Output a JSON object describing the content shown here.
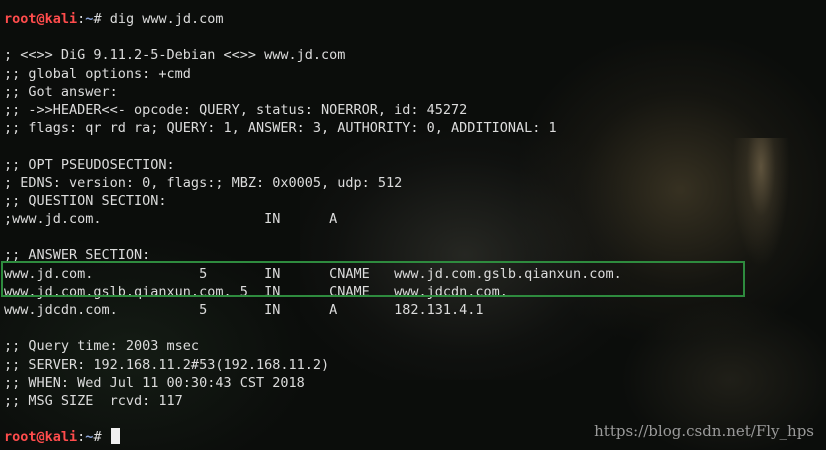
{
  "prompt": {
    "user": "root@kali",
    "sep": ":",
    "path": "~",
    "sym": "# "
  },
  "command": "dig www.jd.com",
  "output": [
    "",
    "; <<>> DiG 9.11.2-5-Debian <<>> www.jd.com",
    ";; global options: +cmd",
    ";; Got answer:",
    ";; ->>HEADER<<- opcode: QUERY, status: NOERROR, id: 45272",
    ";; flags: qr rd ra; QUERY: 1, ANSWER: 3, AUTHORITY: 0, ADDITIONAL: 1",
    "",
    ";; OPT PSEUDOSECTION:",
    "; EDNS: version: 0, flags:; MBZ: 0x0005, udp: 512",
    ";; QUESTION SECTION:",
    ";www.jd.com.                    IN      A",
    "",
    ";; ANSWER SECTION:",
    "www.jd.com.             5       IN      CNAME   www.jd.com.gslb.qianxun.com.",
    "www.jd.com.gslb.qianxun.com. 5  IN      CNAME   www.jdcdn.com.",
    "www.jdcdn.com.          5       IN      A       182.131.4.1",
    "",
    ";; Query time: 2003 msec",
    ";; SERVER: 192.168.11.2#53(192.168.11.2)",
    ";; WHEN: Wed Jul 11 00:30:43 CST 2018",
    ";; MSG SIZE  rcvd: 117",
    ""
  ],
  "watermark": "https://blog.csdn.net/Fly_hps",
  "colors": {
    "highlight_box": "#2e8b3e",
    "prompt_user": "#ff4c4c",
    "prompt_path": "#8aa4d8"
  }
}
